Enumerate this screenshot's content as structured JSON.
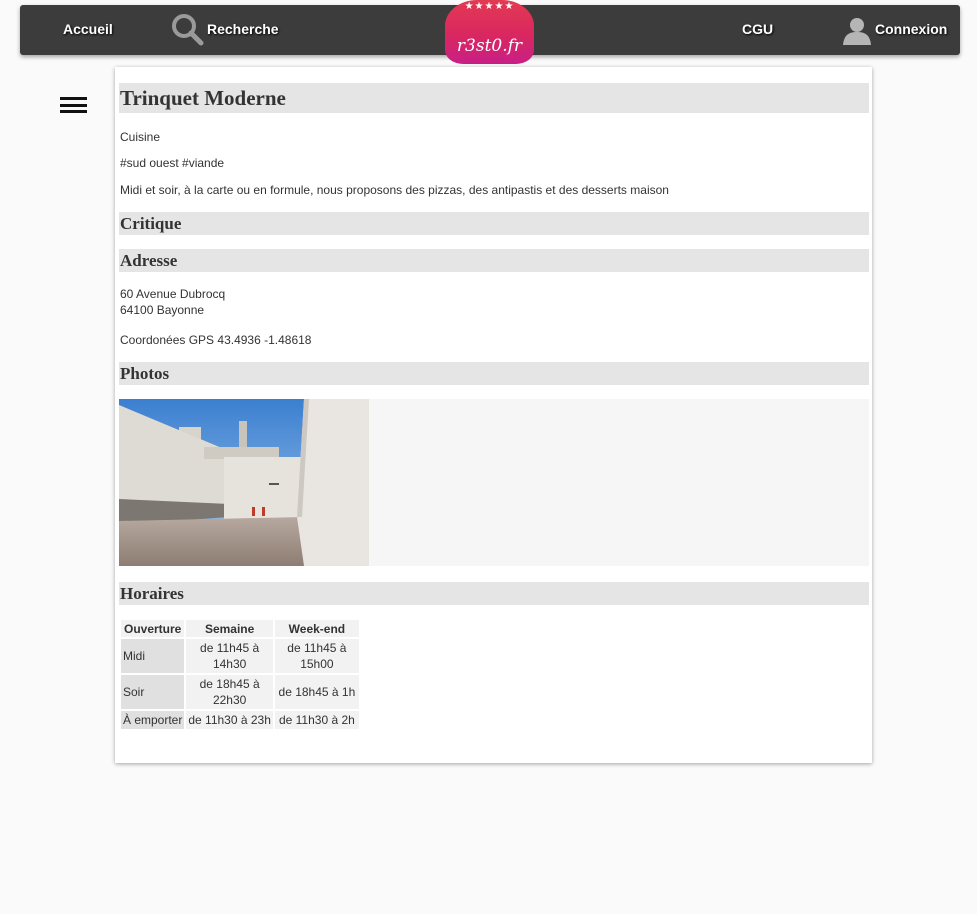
{
  "nav": {
    "home": "Accueil",
    "search": "Recherche",
    "cgu": "CGU",
    "login": "Connexion",
    "logo_text": "r3st0.fr",
    "logo_stars": "★★★★★"
  },
  "restaurant": {
    "name": "Trinquet Moderne",
    "category": "Cuisine",
    "tags": "#sud ouest #viande",
    "description": "Midi et soir, à la carte ou en formule, nous proposons des pizzas, des antipastis et des desserts maison"
  },
  "sections": {
    "critique": "Critique",
    "adresse": "Adresse",
    "photos": "Photos",
    "horaires": "Horaires"
  },
  "address": {
    "street": "60 Avenue Dubrocq",
    "city": "64100 Bayonne",
    "gps": "Coordonées GPS 43.4936 -1.48618"
  },
  "hours": {
    "headers": [
      "Ouverture",
      "Semaine",
      "Week-end"
    ],
    "rows": [
      {
        "label": "Midi",
        "week": "de 11h45 à 14h30",
        "weekend": "de 11h45 à 15h00"
      },
      {
        "label": "Soir",
        "week": "de 18h45 à 22h30",
        "weekend": "de 18h45 à 1h"
      },
      {
        "label": "À emporter",
        "week": "de 11h30 à 23h",
        "weekend": "de 11h30 à 2h"
      }
    ]
  },
  "colors": {
    "navbar": "#3c3c3c",
    "section_bg": "#e5e5e5",
    "logo_gradient_top": "#e23a52",
    "logo_gradient_bottom": "#c81f86"
  },
  "icons": {
    "search": "search-icon",
    "user": "user-icon",
    "menu": "hamburger-menu-icon"
  }
}
